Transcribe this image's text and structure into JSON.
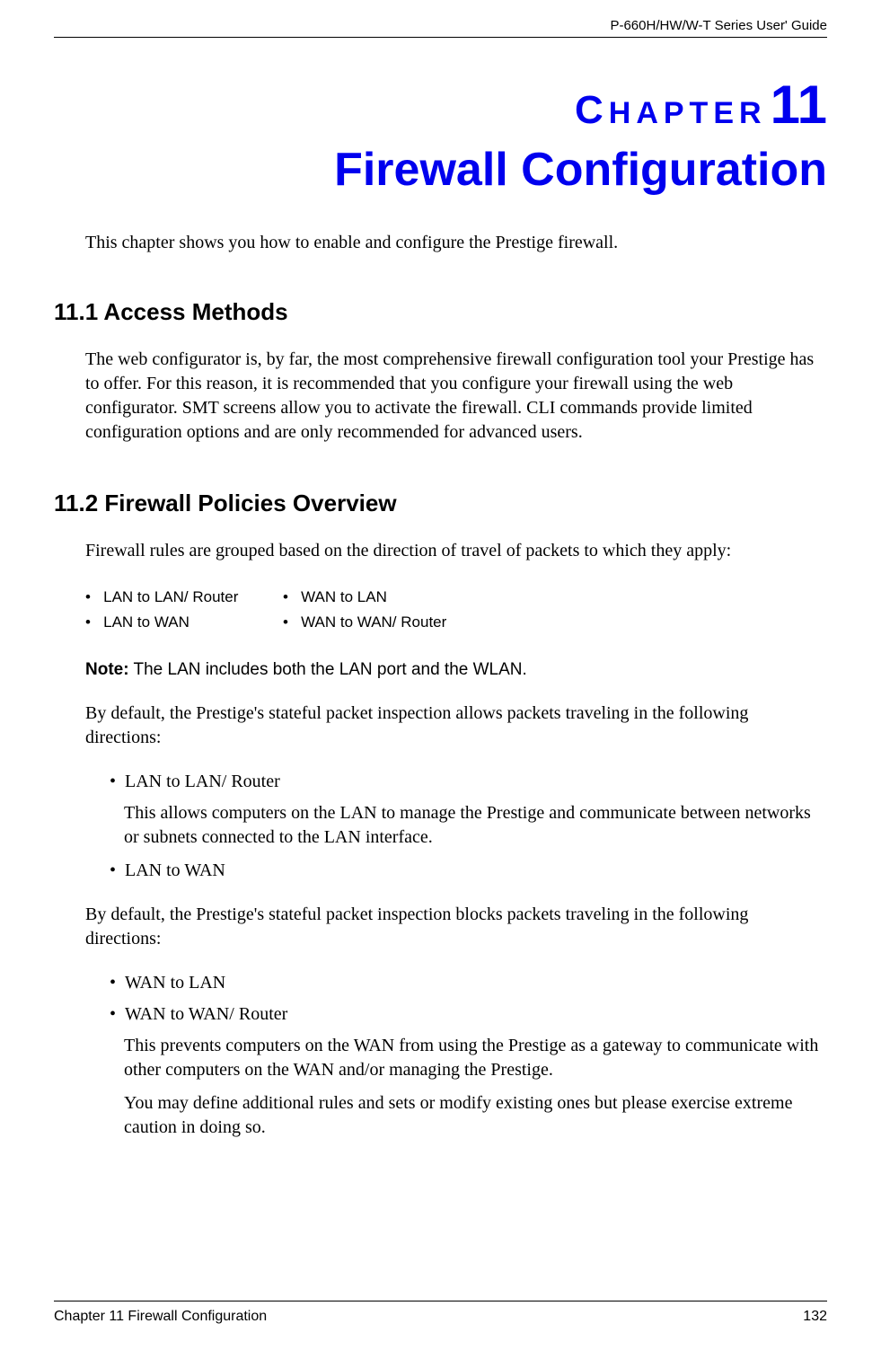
{
  "header": {
    "guide_name": "P-660H/HW/W-T Series User' Guide"
  },
  "chapter": {
    "label_text": "HAPTER",
    "label_prefix": "C",
    "number": "11",
    "title": "Firewall Configuration"
  },
  "intro": "This chapter shows you how to enable and configure the Prestige firewall.",
  "sections": {
    "s11_1": {
      "heading": "11.1  Access Methods",
      "body": "The web configurator is, by far, the most comprehensive firewall configuration tool your Prestige has to offer. For this reason, it is recommended that you configure your firewall using the web configurator. SMT screens allow you to activate the firewall. CLI commands provide limited configuration options and are only recommended for advanced users."
    },
    "s11_2": {
      "heading": "11.2  Firewall Policies Overview",
      "body_intro": "Firewall rules are grouped based on the direction of travel of packets to which they apply:",
      "directions": {
        "c1r1": "LAN to LAN/ Router",
        "c1r2": "LAN to WAN",
        "c2r1": "WAN to LAN",
        "c2r2": "WAN to WAN/ Router"
      },
      "note_label": "Note:",
      "note_text": " The LAN includes both the LAN port and the WLAN.",
      "allows_intro": "By default, the Prestige's stateful packet inspection allows packets traveling in the following directions:",
      "allows_items": {
        "i1": "LAN to LAN/ Router",
        "i1_desc": "This allows computers on the LAN to manage the Prestige and communicate between networks or subnets connected to the LAN interface.",
        "i2": "LAN to WAN"
      },
      "blocks_intro": "By default, the Prestige's stateful packet inspection blocks packets traveling in the following directions:",
      "blocks_items": {
        "i1": "WAN to LAN",
        "i2": "WAN to WAN/ Router",
        "i2_desc": "This prevents computers on the WAN from using the Prestige as a gateway to communicate with other computers on the WAN and/or managing the Prestige.",
        "i2_more": "You may define additional rules and sets or modify existing ones but please exercise extreme caution in doing so."
      }
    }
  },
  "footer": {
    "chapter_ref": "Chapter 11 Firewall Configuration",
    "page_number": "132"
  }
}
